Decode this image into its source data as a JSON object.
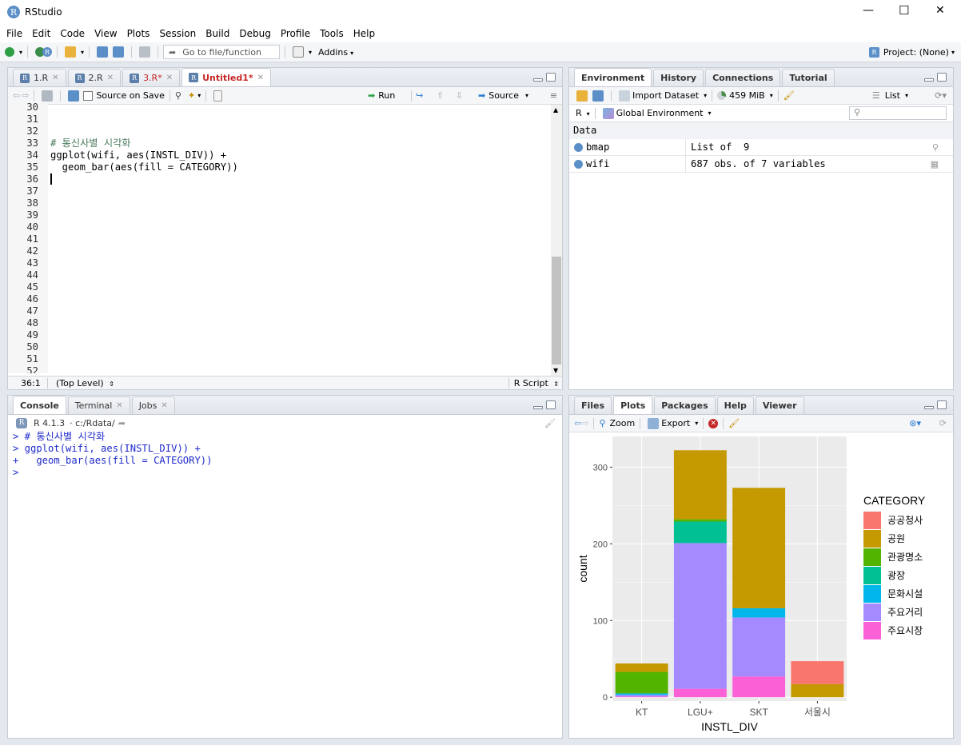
{
  "window": {
    "title": "RStudio",
    "controls": {
      "min": "—",
      "max": "☐",
      "close": "✕"
    }
  },
  "menu": [
    "File",
    "Edit",
    "Code",
    "View",
    "Plots",
    "Session",
    "Build",
    "Debug",
    "Profile",
    "Tools",
    "Help"
  ],
  "toolbar": {
    "goto_placeholder": "Go to file/function",
    "addins": "Addins",
    "project": "Project: (None)"
  },
  "editor": {
    "tabs": [
      {
        "label": "1.R",
        "unsaved": false
      },
      {
        "label": "2.R",
        "unsaved": false
      },
      {
        "label": "3.R*",
        "unsaved": true
      },
      {
        "label": "Untitled1*",
        "unsaved": true,
        "active": true
      }
    ],
    "source_on_save": "Source on Save",
    "run": "Run",
    "source": "Source",
    "lines": [
      {
        "n": "30",
        "code": ""
      },
      {
        "n": "31",
        "code": ""
      },
      {
        "n": "32",
        "code": ""
      },
      {
        "n": "33",
        "code": "# 통신사별 시각화",
        "type": "comment"
      },
      {
        "n": "34",
        "code": "ggplot(wifi, aes(INSTL_DIV)) +"
      },
      {
        "n": "35",
        "code": "  geom_bar(aes(fill = CATEGORY))"
      },
      {
        "n": "36",
        "code": ""
      },
      {
        "n": "37",
        "code": ""
      },
      {
        "n": "38",
        "code": ""
      },
      {
        "n": "39",
        "code": ""
      },
      {
        "n": "40",
        "code": ""
      },
      {
        "n": "41",
        "code": ""
      },
      {
        "n": "42",
        "code": ""
      },
      {
        "n": "43",
        "code": ""
      },
      {
        "n": "44",
        "code": ""
      },
      {
        "n": "45",
        "code": ""
      },
      {
        "n": "46",
        "code": ""
      },
      {
        "n": "47",
        "code": ""
      },
      {
        "n": "48",
        "code": ""
      },
      {
        "n": "49",
        "code": ""
      },
      {
        "n": "50",
        "code": ""
      },
      {
        "n": "51",
        "code": ""
      },
      {
        "n": "52",
        "code": ""
      }
    ],
    "status": {
      "pos": "36:1",
      "scope": "(Top Level)",
      "lang": "R Script"
    }
  },
  "console": {
    "tabs": [
      "Console",
      "Terminal",
      "Jobs"
    ],
    "version": "R 4.1.3",
    "path": "· c:/Rdata/",
    "lines": [
      "> # 통신사별 시각화",
      "> ggplot(wifi, aes(INSTL_DIV)) +",
      "+   geom_bar(aes(fill = CATEGORY))",
      "> "
    ]
  },
  "env": {
    "tabs": [
      "Environment",
      "History",
      "Connections",
      "Tutorial"
    ],
    "import": "Import Dataset",
    "memory": "459 MiB",
    "view": "List",
    "lang": "R",
    "scope": "Global Environment",
    "section": "Data",
    "rows": [
      {
        "name": "bmap",
        "value": "List of  9"
      },
      {
        "name": "wifi",
        "value": "687 obs. of 7 variables"
      }
    ]
  },
  "files": {
    "tabs": [
      "Files",
      "Plots",
      "Packages",
      "Help",
      "Viewer"
    ],
    "zoom": "Zoom",
    "export": "Export"
  },
  "chart_data": {
    "type": "bar",
    "categories": [
      "KT",
      "LGU+",
      "SKT",
      "서울시"
    ],
    "xlabel": "INSTL_DIV",
    "ylabel": "count",
    "ylim": [
      0,
      340
    ],
    "yticks": [
      0,
      100,
      200,
      300
    ],
    "legend_title": "CATEGORY",
    "legend_position": "right",
    "grid": true,
    "series": [
      {
        "name": "공공청사",
        "color": "#F8766D",
        "values": [
          0,
          0,
          0,
          30
        ]
      },
      {
        "name": "공원",
        "color": "#C49A00",
        "values": [
          11,
          90,
          157,
          17
        ]
      },
      {
        "name": "관광명소",
        "color": "#53B400",
        "values": [
          28,
          3,
          0,
          0
        ]
      },
      {
        "name": "광장",
        "color": "#00C094",
        "values": [
          0,
          28,
          0,
          0
        ]
      },
      {
        "name": "문화시설",
        "color": "#00B6EB",
        "values": [
          2,
          0,
          12,
          0
        ]
      },
      {
        "name": "주요거리",
        "color": "#A58AFF",
        "values": [
          2,
          190,
          77,
          0
        ]
      },
      {
        "name": "주요시장",
        "color": "#FB61D7",
        "values": [
          1,
          11,
          27,
          0
        ]
      }
    ]
  }
}
